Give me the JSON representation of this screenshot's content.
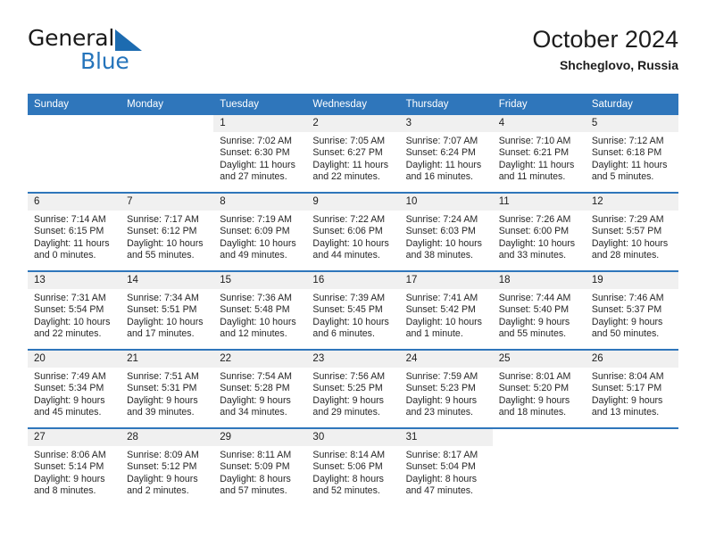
{
  "brand": {
    "name_top": "General",
    "name_bottom": "Blue",
    "accent_color": "#2574bb",
    "mark": "triangle-flag"
  },
  "header": {
    "title": "October 2024",
    "subtitle": "Shcheglovo, Russia"
  },
  "theme": {
    "header_blue": "#2f76bb",
    "daynum_band": "#f0f0f0",
    "text": "#1d1d1d"
  },
  "weekdays": [
    "Sunday",
    "Monday",
    "Tuesday",
    "Wednesday",
    "Thursday",
    "Friday",
    "Saturday"
  ],
  "weeks": [
    [
      {
        "day": "",
        "lines": []
      },
      {
        "day": "",
        "lines": []
      },
      {
        "day": "1",
        "lines": [
          "Sunrise: 7:02 AM",
          "Sunset: 6:30 PM",
          "Daylight: 11 hours",
          "and 27 minutes."
        ]
      },
      {
        "day": "2",
        "lines": [
          "Sunrise: 7:05 AM",
          "Sunset: 6:27 PM",
          "Daylight: 11 hours",
          "and 22 minutes."
        ]
      },
      {
        "day": "3",
        "lines": [
          "Sunrise: 7:07 AM",
          "Sunset: 6:24 PM",
          "Daylight: 11 hours",
          "and 16 minutes."
        ]
      },
      {
        "day": "4",
        "lines": [
          "Sunrise: 7:10 AM",
          "Sunset: 6:21 PM",
          "Daylight: 11 hours",
          "and 11 minutes."
        ]
      },
      {
        "day": "5",
        "lines": [
          "Sunrise: 7:12 AM",
          "Sunset: 6:18 PM",
          "Daylight: 11 hours",
          "and 5 minutes."
        ]
      }
    ],
    [
      {
        "day": "6",
        "lines": [
          "Sunrise: 7:14 AM",
          "Sunset: 6:15 PM",
          "Daylight: 11 hours",
          "and 0 minutes."
        ]
      },
      {
        "day": "7",
        "lines": [
          "Sunrise: 7:17 AM",
          "Sunset: 6:12 PM",
          "Daylight: 10 hours",
          "and 55 minutes."
        ]
      },
      {
        "day": "8",
        "lines": [
          "Sunrise: 7:19 AM",
          "Sunset: 6:09 PM",
          "Daylight: 10 hours",
          "and 49 minutes."
        ]
      },
      {
        "day": "9",
        "lines": [
          "Sunrise: 7:22 AM",
          "Sunset: 6:06 PM",
          "Daylight: 10 hours",
          "and 44 minutes."
        ]
      },
      {
        "day": "10",
        "lines": [
          "Sunrise: 7:24 AM",
          "Sunset: 6:03 PM",
          "Daylight: 10 hours",
          "and 38 minutes."
        ]
      },
      {
        "day": "11",
        "lines": [
          "Sunrise: 7:26 AM",
          "Sunset: 6:00 PM",
          "Daylight: 10 hours",
          "and 33 minutes."
        ]
      },
      {
        "day": "12",
        "lines": [
          "Sunrise: 7:29 AM",
          "Sunset: 5:57 PM",
          "Daylight: 10 hours",
          "and 28 minutes."
        ]
      }
    ],
    [
      {
        "day": "13",
        "lines": [
          "Sunrise: 7:31 AM",
          "Sunset: 5:54 PM",
          "Daylight: 10 hours",
          "and 22 minutes."
        ]
      },
      {
        "day": "14",
        "lines": [
          "Sunrise: 7:34 AM",
          "Sunset: 5:51 PM",
          "Daylight: 10 hours",
          "and 17 minutes."
        ]
      },
      {
        "day": "15",
        "lines": [
          "Sunrise: 7:36 AM",
          "Sunset: 5:48 PM",
          "Daylight: 10 hours",
          "and 12 minutes."
        ]
      },
      {
        "day": "16",
        "lines": [
          "Sunrise: 7:39 AM",
          "Sunset: 5:45 PM",
          "Daylight: 10 hours",
          "and 6 minutes."
        ]
      },
      {
        "day": "17",
        "lines": [
          "Sunrise: 7:41 AM",
          "Sunset: 5:42 PM",
          "Daylight: 10 hours",
          "and 1 minute."
        ]
      },
      {
        "day": "18",
        "lines": [
          "Sunrise: 7:44 AM",
          "Sunset: 5:40 PM",
          "Daylight: 9 hours",
          "and 55 minutes."
        ]
      },
      {
        "day": "19",
        "lines": [
          "Sunrise: 7:46 AM",
          "Sunset: 5:37 PM",
          "Daylight: 9 hours",
          "and 50 minutes."
        ]
      }
    ],
    [
      {
        "day": "20",
        "lines": [
          "Sunrise: 7:49 AM",
          "Sunset: 5:34 PM",
          "Daylight: 9 hours",
          "and 45 minutes."
        ]
      },
      {
        "day": "21",
        "lines": [
          "Sunrise: 7:51 AM",
          "Sunset: 5:31 PM",
          "Daylight: 9 hours",
          "and 39 minutes."
        ]
      },
      {
        "day": "22",
        "lines": [
          "Sunrise: 7:54 AM",
          "Sunset: 5:28 PM",
          "Daylight: 9 hours",
          "and 34 minutes."
        ]
      },
      {
        "day": "23",
        "lines": [
          "Sunrise: 7:56 AM",
          "Sunset: 5:25 PM",
          "Daylight: 9 hours",
          "and 29 minutes."
        ]
      },
      {
        "day": "24",
        "lines": [
          "Sunrise: 7:59 AM",
          "Sunset: 5:23 PM",
          "Daylight: 9 hours",
          "and 23 minutes."
        ]
      },
      {
        "day": "25",
        "lines": [
          "Sunrise: 8:01 AM",
          "Sunset: 5:20 PM",
          "Daylight: 9 hours",
          "and 18 minutes."
        ]
      },
      {
        "day": "26",
        "lines": [
          "Sunrise: 8:04 AM",
          "Sunset: 5:17 PM",
          "Daylight: 9 hours",
          "and 13 minutes."
        ]
      }
    ],
    [
      {
        "day": "27",
        "lines": [
          "Sunrise: 8:06 AM",
          "Sunset: 5:14 PM",
          "Daylight: 9 hours",
          "and 8 minutes."
        ]
      },
      {
        "day": "28",
        "lines": [
          "Sunrise: 8:09 AM",
          "Sunset: 5:12 PM",
          "Daylight: 9 hours",
          "and 2 minutes."
        ]
      },
      {
        "day": "29",
        "lines": [
          "Sunrise: 8:11 AM",
          "Sunset: 5:09 PM",
          "Daylight: 8 hours",
          "and 57 minutes."
        ]
      },
      {
        "day": "30",
        "lines": [
          "Sunrise: 8:14 AM",
          "Sunset: 5:06 PM",
          "Daylight: 8 hours",
          "and 52 minutes."
        ]
      },
      {
        "day": "31",
        "lines": [
          "Sunrise: 8:17 AM",
          "Sunset: 5:04 PM",
          "Daylight: 8 hours",
          "and 47 minutes."
        ]
      },
      {
        "day": "",
        "lines": []
      },
      {
        "day": "",
        "lines": []
      }
    ]
  ]
}
